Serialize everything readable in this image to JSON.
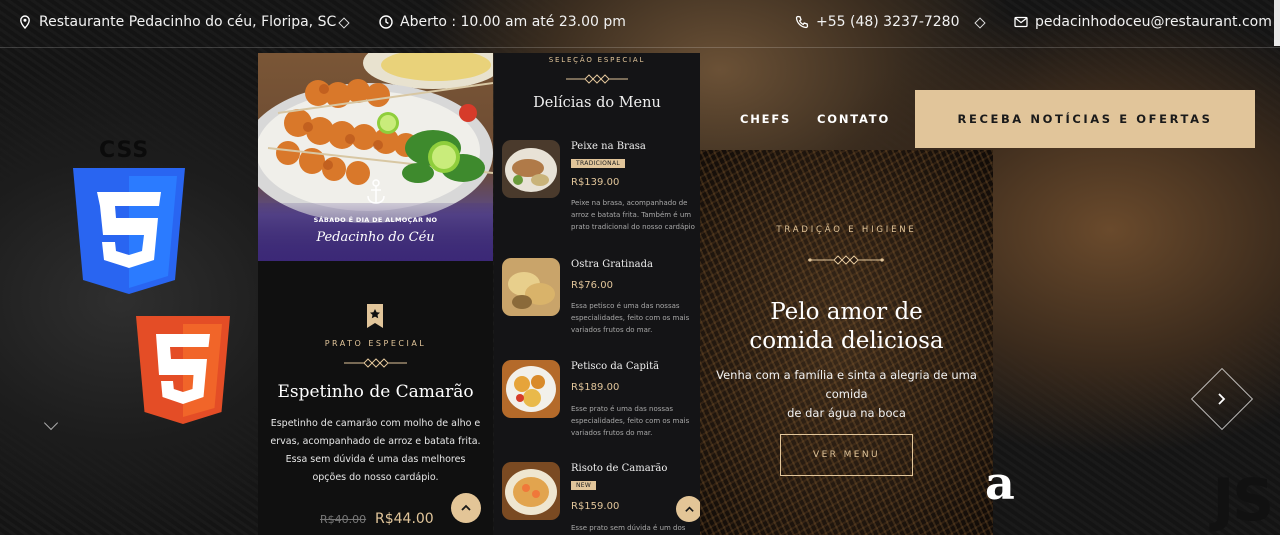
{
  "topbar": {
    "address": "Restaurante Pedacinho do céu, Floripa, SC",
    "hours": "Aberto : 10.00 am até 23.00 pm",
    "phone": "+55 (48) 3237-7280",
    "email": "pedacinhodoceu@restaurant.com"
  },
  "tech_logos": {
    "css_label": "CSS",
    "js_label": "JS"
  },
  "feature": {
    "banner_line1": "SÁBADO É DIA DE ALMOÇAR NO",
    "banner_line2": "Pedacinho do Céu",
    "subtitle": "PRATO ESPECIAL",
    "title": "Espetinho de Camarão",
    "description": "Espetinho de camarão com molho de alho e ervas, acompanhado de arroz e batata frita. Essa sem dúvida é uma das melhores opções do nosso cardápio.",
    "old_price": "R$40.00",
    "price": "R$44.00"
  },
  "menu": {
    "subtitle": "SELEÇÃO ESPECIAL",
    "title": "Delícias do Menu",
    "items": [
      {
        "name": "Peixe na Brasa",
        "tag": "TRADICIONAL",
        "price": "R$139.00",
        "desc": [
          "Peixe na brasa, acompanhado de",
          "arroz e batata frita. Também é um",
          "prato tradicional do nosso cardápio"
        ]
      },
      {
        "name": "Ostra Gratinada",
        "tag": "",
        "price": "R$76.00",
        "desc": [
          "Essa petisco é uma das nossas",
          "especialidades, feito com os mais",
          "variados frutos do mar."
        ]
      },
      {
        "name": "Petisco da Capitã",
        "tag": "",
        "price": "R$189.00",
        "desc": [
          "Esse prato é uma das nossas",
          "especialidades, feito com os mais",
          "variados frutos do mar."
        ]
      },
      {
        "name": "Risoto de Camarão",
        "tag": "NEW",
        "price": "R$159.00",
        "desc": [
          "Esse prato sem dúvida é um dos"
        ]
      }
    ]
  },
  "nav": {
    "chefs": "CHEFS",
    "contato": "CONTATO",
    "cta": "RECEBA NOTÍCIAS E OFERTAS"
  },
  "hero": {
    "subtitle": "TRADIÇÃO E HIGIENE",
    "title_line1": "Pelo amor de",
    "title_line2": "comida deliciosa",
    "desc_line1": "Venha com a família e sinta a alegria de uma comida",
    "desc_line2": "de dar água na boca",
    "button": "VER MENU"
  },
  "stray_letter": "a",
  "colors": {
    "accent": "#e1c59a",
    "dark": "#141414",
    "js_yellow": "#f0db1b",
    "css_blue": "#2965f1",
    "html_orange": "#e44d26"
  }
}
